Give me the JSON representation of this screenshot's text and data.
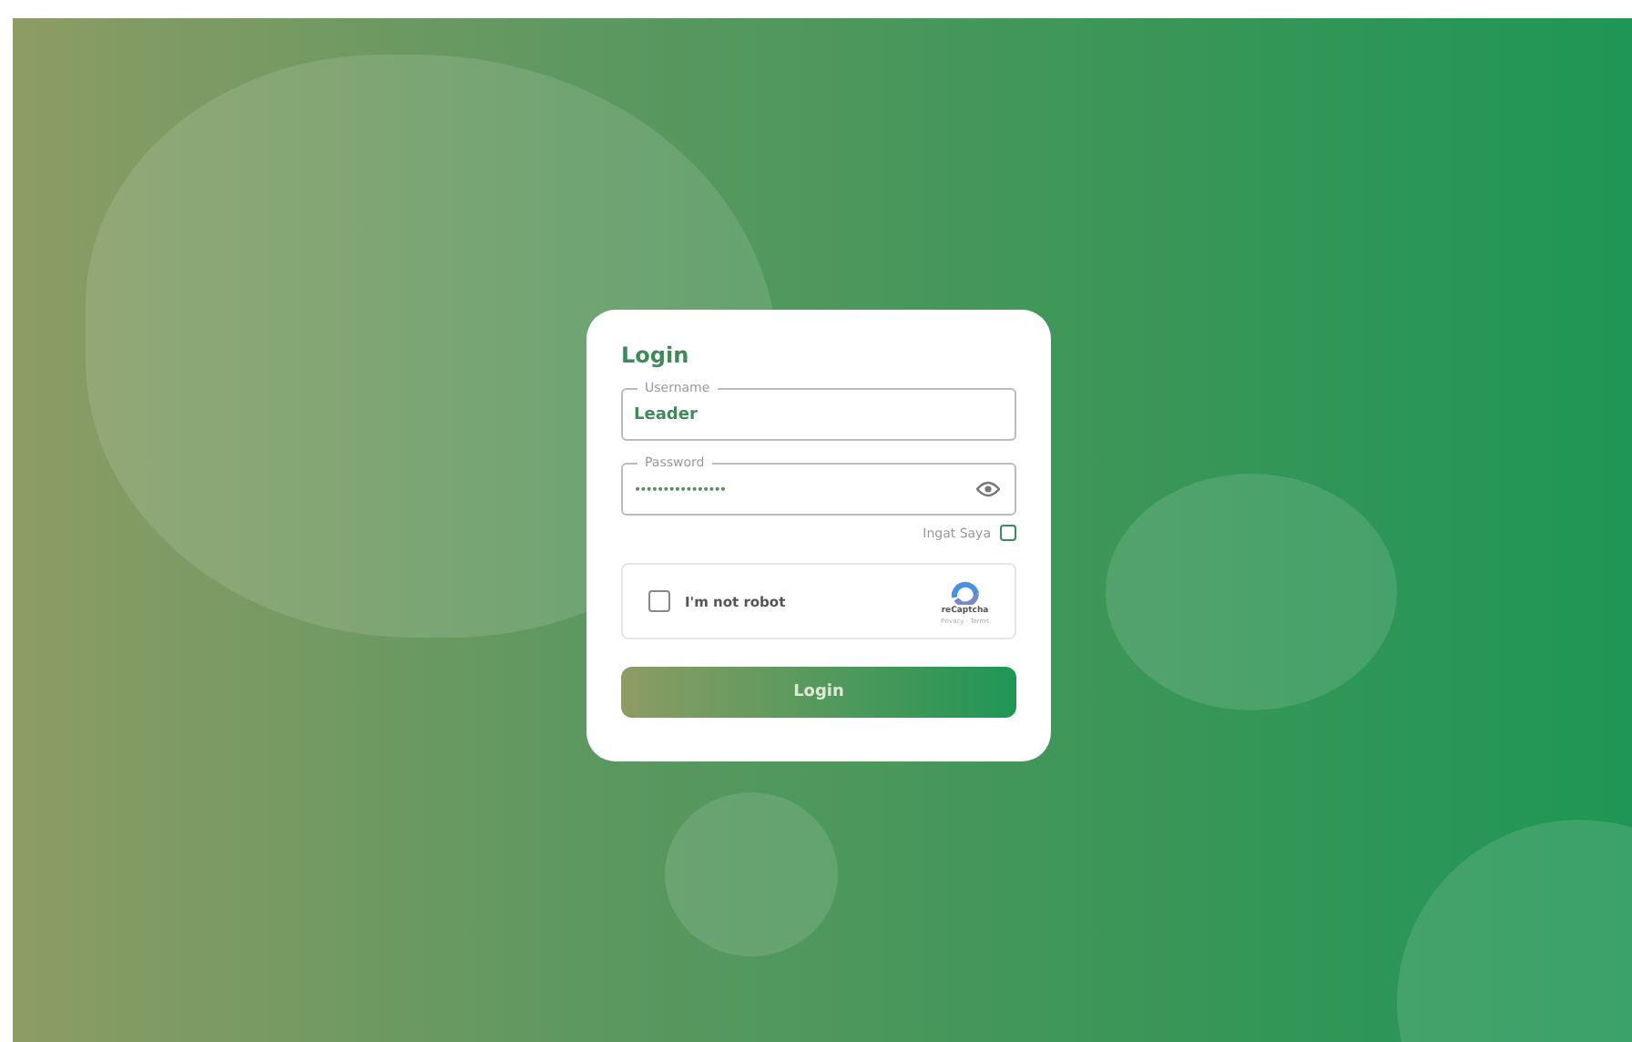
{
  "login": {
    "title": "Login",
    "username": {
      "label": "Username",
      "value": "Leader"
    },
    "password": {
      "label": "Password",
      "value": "••••••••••••••••"
    },
    "remember": {
      "label": "Ingat Saya",
      "checked": false
    },
    "captcha": {
      "label": "I'm not robot",
      "checked": false,
      "brand": "reCaptcha",
      "links": "Privacy - Terms"
    },
    "button": "Login"
  }
}
